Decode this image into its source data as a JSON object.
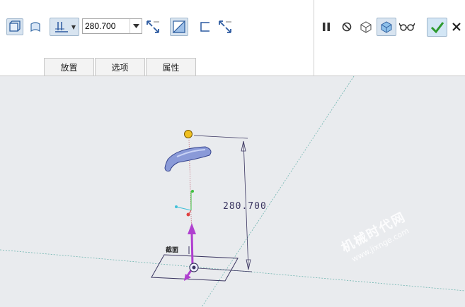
{
  "toolbar": {
    "depth_value": "280.700",
    "tabs": [
      "放置",
      "选项",
      "属性"
    ]
  },
  "viewport": {
    "dimension_value": "280.700",
    "plane_label": "截面"
  },
  "watermark": {
    "line1": "机械时代网",
    "line2": "www.jixnge.com"
  },
  "colors": {
    "confirm": "#2e9a2e",
    "handle": "#f0c020",
    "arrow": "#b040d0",
    "part": "#8a9ad8"
  }
}
